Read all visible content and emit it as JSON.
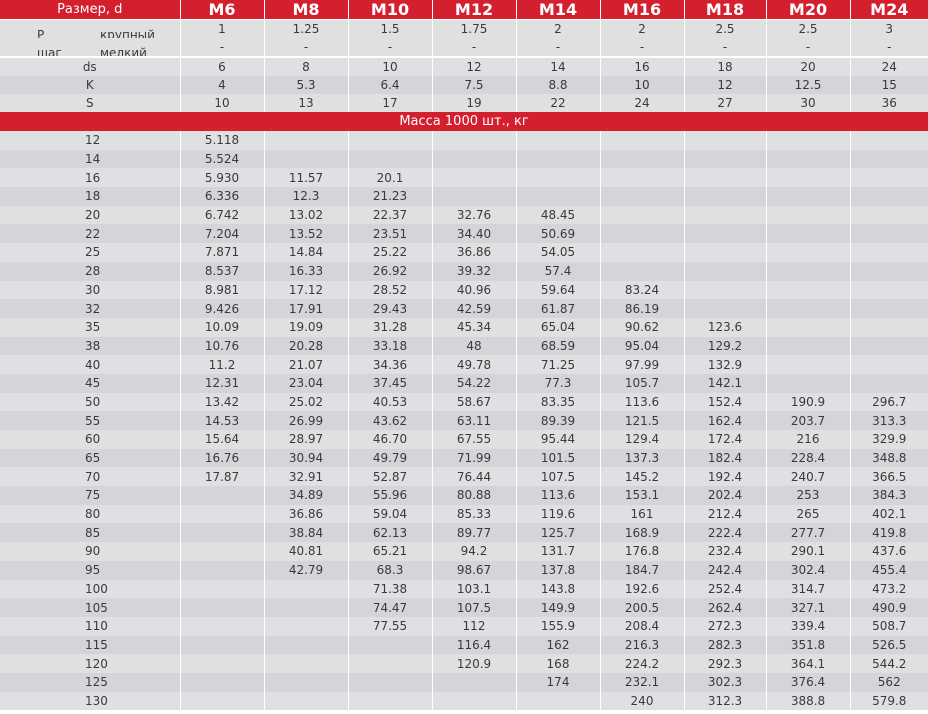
{
  "header": {
    "size_label": "Размер, d",
    "sizes": [
      "M6",
      "M8",
      "M10",
      "M12",
      "M14",
      "M16",
      "M18",
      "M20",
      "M24"
    ]
  },
  "pitch": {
    "p_label": "P",
    "shag_label": "шаг",
    "coarse_label": "крупный",
    "fine_label": "мелкий",
    "coarse": [
      "1",
      "1.25",
      "1.5",
      "1.75",
      "2",
      "2",
      "2.5",
      "2.5",
      "3"
    ],
    "fine": [
      "-",
      "-",
      "-",
      "-",
      "-",
      "-",
      "-",
      "-",
      "-"
    ]
  },
  "dims": [
    {
      "label": "ds",
      "values": [
        "6",
        "8",
        "10",
        "12",
        "14",
        "16",
        "18",
        "20",
        "24"
      ]
    },
    {
      "label": "K",
      "values": [
        "4",
        "5.3",
        "6.4",
        "7.5",
        "8.8",
        "10",
        "12",
        "12.5",
        "15"
      ]
    },
    {
      "label": "S",
      "values": [
        "10",
        "13",
        "17",
        "19",
        "22",
        "24",
        "27",
        "30",
        "36"
      ]
    }
  ],
  "mass_title": "Масса 1000 шт., кг",
  "rows": [
    {
      "len": "12",
      "v": [
        "5.118",
        "",
        "",
        "",
        "",
        "",
        "",
        "",
        ""
      ]
    },
    {
      "len": "14",
      "v": [
        "5.524",
        "",
        "",
        "",
        "",
        "",
        "",
        "",
        ""
      ]
    },
    {
      "len": "16",
      "v": [
        "5.930",
        "11.57",
        "20.1",
        "",
        "",
        "",
        "",
        "",
        ""
      ]
    },
    {
      "len": "18",
      "v": [
        "6.336",
        "12.3",
        "21.23",
        "",
        "",
        "",
        "",
        "",
        ""
      ]
    },
    {
      "len": "20",
      "v": [
        "6.742",
        "13.02",
        "22.37",
        "32.76",
        "48.45",
        "",
        "",
        "",
        ""
      ]
    },
    {
      "len": "22",
      "v": [
        "7.204",
        "13.52",
        "23.51",
        "34.40",
        "50.69",
        "",
        "",
        "",
        ""
      ]
    },
    {
      "len": "25",
      "v": [
        "7.871",
        "14.84",
        "25.22",
        "36.86",
        "54.05",
        "",
        "",
        "",
        ""
      ]
    },
    {
      "len": "28",
      "v": [
        "8.537",
        "16.33",
        "26.92",
        "39.32",
        "57.4",
        "",
        "",
        "",
        ""
      ]
    },
    {
      "len": "30",
      "v": [
        "8.981",
        "17.12",
        "28.52",
        "40.96",
        "59.64",
        "83.24",
        "",
        "",
        ""
      ]
    },
    {
      "len": "32",
      "v": [
        "9.426",
        "17.91",
        "29.43",
        "42.59",
        "61.87",
        "86.19",
        "",
        "",
        ""
      ]
    },
    {
      "len": "35",
      "v": [
        "10.09",
        "19.09",
        "31.28",
        "45.34",
        "65.04",
        "90.62",
        "123.6",
        "",
        ""
      ]
    },
    {
      "len": "38",
      "v": [
        "10.76",
        "20.28",
        "33.18",
        "48",
        "68.59",
        "95.04",
        "129.2",
        "",
        ""
      ]
    },
    {
      "len": "40",
      "v": [
        "11.2",
        "21.07",
        "34.36",
        "49.78",
        "71.25",
        "97.99",
        "132.9",
        "",
        ""
      ]
    },
    {
      "len": "45",
      "v": [
        "12.31",
        "23.04",
        "37.45",
        "54.22",
        "77.3",
        "105.7",
        "142.1",
        "",
        ""
      ]
    },
    {
      "len": "50",
      "v": [
        "13.42",
        "25.02",
        "40.53",
        "58.67",
        "83.35",
        "113.6",
        "152.4",
        "190.9",
        "296.7"
      ]
    },
    {
      "len": "55",
      "v": [
        "14.53",
        "26.99",
        "43.62",
        "63.11",
        "89.39",
        "121.5",
        "162.4",
        "203.7",
        "313.3"
      ]
    },
    {
      "len": "60",
      "v": [
        "15.64",
        "28.97",
        "46.70",
        "67.55",
        "95.44",
        "129.4",
        "172.4",
        "216",
        "329.9"
      ]
    },
    {
      "len": "65",
      "v": [
        "16.76",
        "30.94",
        "49.79",
        "71.99",
        "101.5",
        "137.3",
        "182.4",
        "228.4",
        "348.8"
      ]
    },
    {
      "len": "70",
      "v": [
        "17.87",
        "32.91",
        "52.87",
        "76.44",
        "107.5",
        "145.2",
        "192.4",
        "240.7",
        "366.5"
      ]
    },
    {
      "len": "75",
      "v": [
        "",
        "34.89",
        "55.96",
        "80.88",
        "113.6",
        "153.1",
        "202.4",
        "253",
        "384.3"
      ]
    },
    {
      "len": "80",
      "v": [
        "",
        "36.86",
        "59.04",
        "85.33",
        "119.6",
        "161",
        "212.4",
        "265",
        "402.1"
      ]
    },
    {
      "len": "85",
      "v": [
        "",
        "38.84",
        "62.13",
        "89.77",
        "125.7",
        "168.9",
        "222.4",
        "277.7",
        "419.8"
      ]
    },
    {
      "len": "90",
      "v": [
        "",
        "40.81",
        "65.21",
        "94.2",
        "131.7",
        "176.8",
        "232.4",
        "290.1",
        "437.6"
      ]
    },
    {
      "len": "95",
      "v": [
        "",
        "42.79",
        "68.3",
        "98.67",
        "137.8",
        "184.7",
        "242.4",
        "302.4",
        "455.4"
      ]
    },
    {
      "len": "100",
      "v": [
        "",
        "",
        "71.38",
        "103.1",
        "143.8",
        "192.6",
        "252.4",
        "314.7",
        "473.2"
      ]
    },
    {
      "len": "105",
      "v": [
        "",
        "",
        "74.47",
        "107.5",
        "149.9",
        "200.5",
        "262.4",
        "327.1",
        "490.9"
      ]
    },
    {
      "len": "110",
      "v": [
        "",
        "",
        "77.55",
        "112",
        "155.9",
        "208.4",
        "272.3",
        "339.4",
        "508.7"
      ]
    },
    {
      "len": "115",
      "v": [
        "",
        "",
        "",
        "116.4",
        "162",
        "216.3",
        "282.3",
        "351.8",
        "526.5"
      ]
    },
    {
      "len": "120",
      "v": [
        "",
        "",
        "",
        "120.9",
        "168",
        "224.2",
        "292.3",
        "364.1",
        "544.2"
      ]
    },
    {
      "len": "125",
      "v": [
        "",
        "",
        "",
        "",
        "174",
        "232.1",
        "302.3",
        "376.4",
        "562"
      ]
    },
    {
      "len": "130",
      "v": [
        "",
        "",
        "",
        "",
        "",
        "240",
        "312.3",
        "388.8",
        "579.8"
      ]
    }
  ]
}
